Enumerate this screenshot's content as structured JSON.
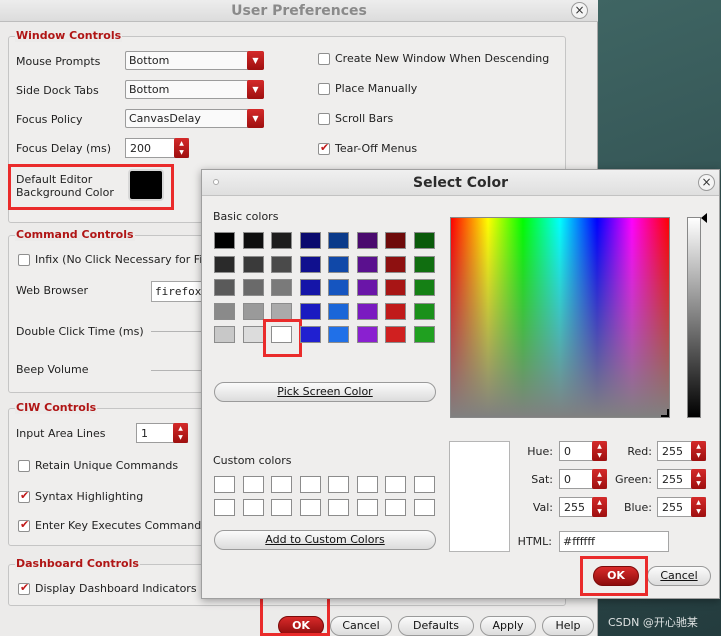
{
  "prefs": {
    "title": "User Preferences",
    "window_controls": {
      "title": "Window Controls",
      "mouse_prompts": {
        "label": "Mouse Prompts",
        "value": "Bottom"
      },
      "side_dock_tabs": {
        "label": "Side Dock Tabs",
        "value": "Bottom"
      },
      "focus_policy": {
        "label": "Focus Policy",
        "value": "CanvasDelay"
      },
      "focus_delay": {
        "label": "Focus Delay (ms)",
        "value": "200"
      },
      "bg_color_line1": "Default Editor",
      "bg_color_line2": "Background Color",
      "bg_color_value": "#000000",
      "create_new_window": {
        "label": "Create New Window When Descending",
        "checked": false
      },
      "place_manually": {
        "label": "Place Manually",
        "checked": false
      },
      "scroll_bars": {
        "label": "Scroll Bars",
        "checked": false
      },
      "tear_off_menus": {
        "label": "Tear-Off Menus",
        "checked": true
      }
    },
    "command_controls": {
      "title": "Command Controls",
      "infix": {
        "label": "Infix (No Click Necessary for First",
        "checked": false
      },
      "web_browser": {
        "label": "Web Browser",
        "value": "firefox"
      },
      "double_click": "Double Click Time (ms)",
      "beep_volume": "Beep Volume"
    },
    "ciw_controls": {
      "title": "CIW Controls",
      "input_area_lines": {
        "label": "Input Area Lines",
        "value": "1"
      },
      "retain_unique": {
        "label": "Retain Unique Commands",
        "checked": false
      },
      "syntax_highlighting": {
        "label": "Syntax Highlighting",
        "checked": true
      },
      "enter_key": {
        "label": "Enter Key Executes Command",
        "checked": true
      }
    },
    "dashboard_controls": {
      "title": "Dashboard Controls",
      "display_indicators": {
        "label": "Display Dashboard Indicators",
        "checked": true
      }
    },
    "buttons": {
      "ok": "OK",
      "cancel": "Cancel",
      "defaults": "Defaults",
      "apply": "Apply",
      "help": "Help"
    }
  },
  "dialog": {
    "title": "Select Color",
    "basic_colors_label": "Basic colors",
    "basic_colors": [
      [
        "#000000",
        "#0e0e0e",
        "#1d1d1d",
        "#0a0a6e",
        "#0a3a8a",
        "#4a0a6e",
        "#6e0a0a",
        "#0a5a0a"
      ],
      [
        "#2a2a2a",
        "#3a3a3a",
        "#4a4a4a",
        "#10108e",
        "#1048a8",
        "#5a108e",
        "#8e1010",
        "#106e10"
      ],
      [
        "#5a5a5a",
        "#6a6a6a",
        "#7a7a7a",
        "#1515a8",
        "#1555c0",
        "#6a15a8",
        "#a81515",
        "#158015"
      ],
      [
        "#8a8a8a",
        "#9a9a9a",
        "#aaaaaa",
        "#1a1ac0",
        "#1a66d8",
        "#7a1ac0",
        "#c01a1a",
        "#1a901a"
      ],
      [
        "#c8c8c8",
        "#dcdcdc",
        "#ffffff",
        "#2020d0",
        "#2070e8",
        "#8a20d0",
        "#d02020",
        "#20a020"
      ]
    ],
    "pick_screen": "Pick Screen Color",
    "custom_colors_label": "Custom colors",
    "add_custom": "Add to Custom Colors",
    "hue": {
      "label": "Hue:",
      "value": "0"
    },
    "sat": {
      "label": "Sat:",
      "value": "0"
    },
    "val": {
      "label": "Val:",
      "value": "255"
    },
    "red": {
      "label": "Red:",
      "value": "255"
    },
    "green": {
      "label": "Green:",
      "value": "255"
    },
    "blue": {
      "label": "Blue:",
      "value": "255"
    },
    "html": {
      "label": "HTML:",
      "value": "#ffffff"
    },
    "ok": "OK",
    "cancel": "Cancel"
  },
  "watermark": "CSDN @开心驰某",
  "colors": {
    "accent": "#b01515",
    "highlight": "#ea2b2b",
    "selected": "#ffffff"
  }
}
